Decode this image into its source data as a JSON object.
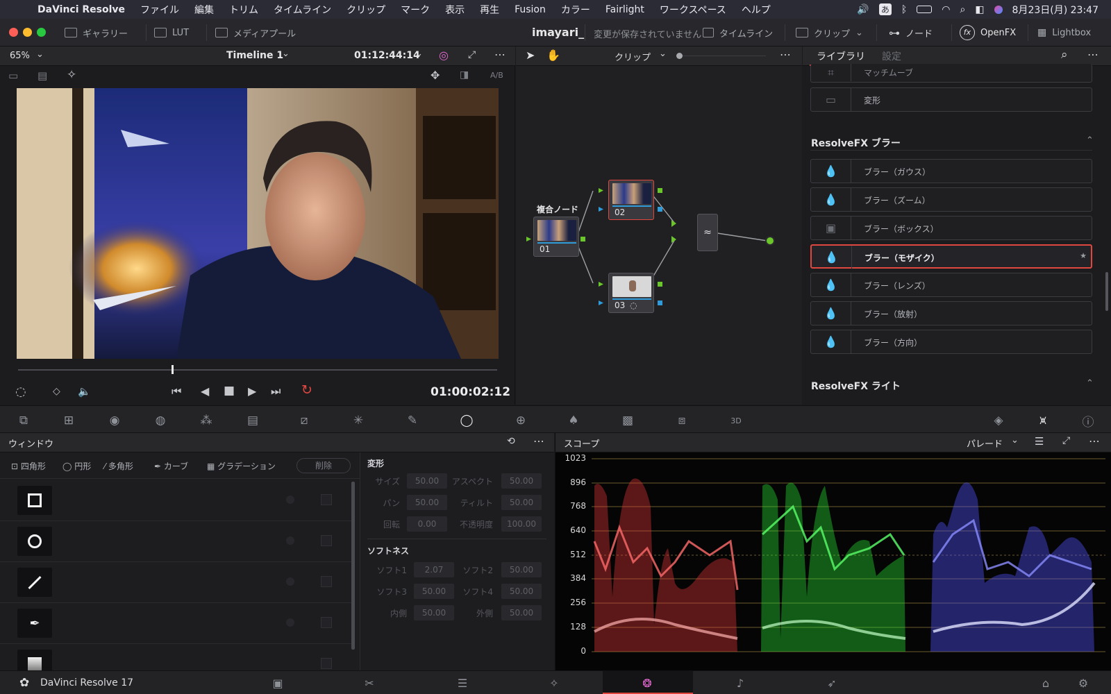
{
  "menubar": {
    "app": "DaVinci Resolve",
    "items": [
      "ファイル",
      "編集",
      "トリム",
      "タイムライン",
      "クリップ",
      "マーク",
      "表示",
      "再生",
      "Fusion",
      "カラー",
      "Fairlight",
      "ワークスペース",
      "ヘルプ"
    ],
    "input_mode": "あ",
    "clock": "8月23日(月)  23:47"
  },
  "titlebar": {
    "gallery": "ギャラリー",
    "lut": "LUT",
    "media_pool": "メディアプール",
    "project": "imayari_",
    "unsaved": "変更が保存されていません",
    "timeline": "タイムライン",
    "clip": "クリップ",
    "nodes": "ノード",
    "openfx": "OpenFX",
    "lightbox": "Lightbox"
  },
  "viewer": {
    "zoom": "65%",
    "timeline_name": "Timeline 1",
    "source_tc": "01:12:44:14",
    "ab": "A/B",
    "playhead_tc": "01:00:02:12",
    "scrub_fraction": 0.32
  },
  "nodes": {
    "mode": "クリップ",
    "compound_label": "複合ノード",
    "n1": "01",
    "n2": "02",
    "n3": "03"
  },
  "library": {
    "tab_library": "ライブラリ",
    "tab_settings": "設定",
    "partial_item": "マッチムーブ",
    "transform_item": "変形",
    "sec_blur": "ResolveFX ブラー",
    "blur_items": [
      "ブラー（ガウス）",
      "ブラー（ズーム）",
      "ブラー（ボックス）",
      "ブラー（モザイク）",
      "ブラー（レンズ）",
      "ブラー（放射）",
      "ブラー（方向）"
    ],
    "sec_light": "ResolveFX ライト"
  },
  "window_panel": {
    "title": "ウィンドウ",
    "types": [
      "四角形",
      "円形",
      "多角形",
      "カーブ",
      "グラデーション"
    ],
    "delete": "削除",
    "transform_title": "変形",
    "size_label": "サイズ",
    "size": "50.00",
    "aspect_label": "アスペクト",
    "aspect": "50.00",
    "pan_label": "パン",
    "pan": "50.00",
    "tilt_label": "ティルト",
    "tilt": "50.00",
    "rotate_label": "回転",
    "rotate": "0.00",
    "opacity_label": "不透明度",
    "opacity": "100.00",
    "softness_title": "ソフトネス",
    "soft1_label": "ソフト1",
    "soft1": "2.07",
    "soft2_label": "ソフト2",
    "soft2": "50.00",
    "soft3_label": "ソフト3",
    "soft3": "50.00",
    "soft4_label": "ソフト4",
    "soft4": "50.00",
    "inside_label": "内側",
    "inside": "50.00",
    "outside_label": "外側",
    "outside": "50.00"
  },
  "scope": {
    "title": "スコープ",
    "mode": "パレード",
    "ticks": [
      "1023",
      "896",
      "768",
      "640",
      "512",
      "384",
      "256",
      "128",
      "0"
    ]
  },
  "footer": {
    "product": "DaVinci Resolve 17"
  },
  "colors": {
    "accent_red": "#e0483f",
    "node_green": "#6bc62b",
    "node_blue": "#2f9bd8",
    "scope_red": "#ff4a4a",
    "scope_green": "#3cff4a",
    "scope_blue": "#5a5dff"
  }
}
